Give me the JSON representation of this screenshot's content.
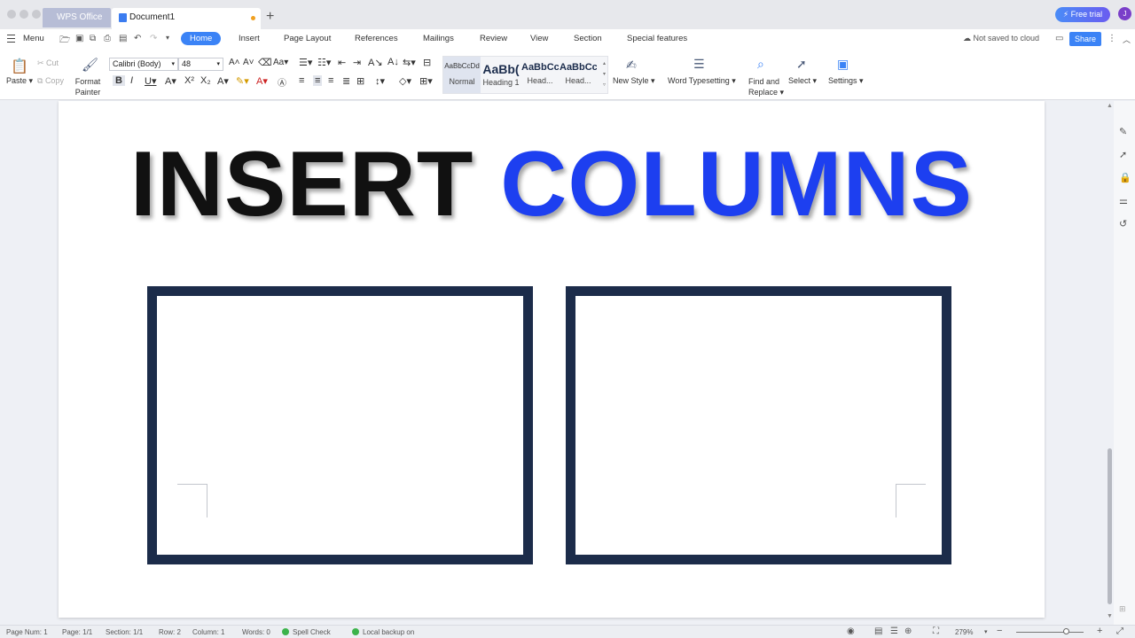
{
  "titlebar": {
    "app_tab": "WPS Office",
    "doc_tab": "Document1",
    "free_trial": "Free trial",
    "avatar": "J"
  },
  "menubar": {
    "menu": "Menu",
    "tabs": [
      "Home",
      "Insert",
      "Page Layout",
      "References",
      "Mailings",
      "Review",
      "View",
      "Section",
      "Special features"
    ],
    "cloud": "Not saved to cloud",
    "share": "Share"
  },
  "ribbon": {
    "paste": "Paste",
    "cut": "Cut",
    "copy": "Copy",
    "format_painter": "Format Painter",
    "font_name": "Calibri (Body)",
    "font_size": "48",
    "styles": [
      {
        "sample": "AaBbCcDd",
        "label": "Normal"
      },
      {
        "sample": "AaBb(",
        "label": "Heading 1"
      },
      {
        "sample": "AaBbCc",
        "label": "Head..."
      },
      {
        "sample": "AaBbCc",
        "label": "Head..."
      }
    ],
    "new_style": "New Style",
    "word_typesetting": "Word Typesetting",
    "find_replace_1": "Find and",
    "find_replace_2": "Replace",
    "select": "Select",
    "settings": "Settings"
  },
  "document": {
    "headline_black": "INSERT",
    "headline_blue": "COLUMNS"
  },
  "statusbar": {
    "page_num": "Page Num: 1",
    "page": "Page: 1/1",
    "section": "Section: 1/1",
    "row": "Row: 2",
    "column": "Column: 1",
    "words": "Words: 0",
    "spell_check": "Spell Check",
    "backup": "Local backup on",
    "zoom": "279%"
  },
  "colors": {
    "accent": "#3b83f6",
    "headline_blue": "#1d3ff0",
    "box_border": "#1c2c4a"
  }
}
